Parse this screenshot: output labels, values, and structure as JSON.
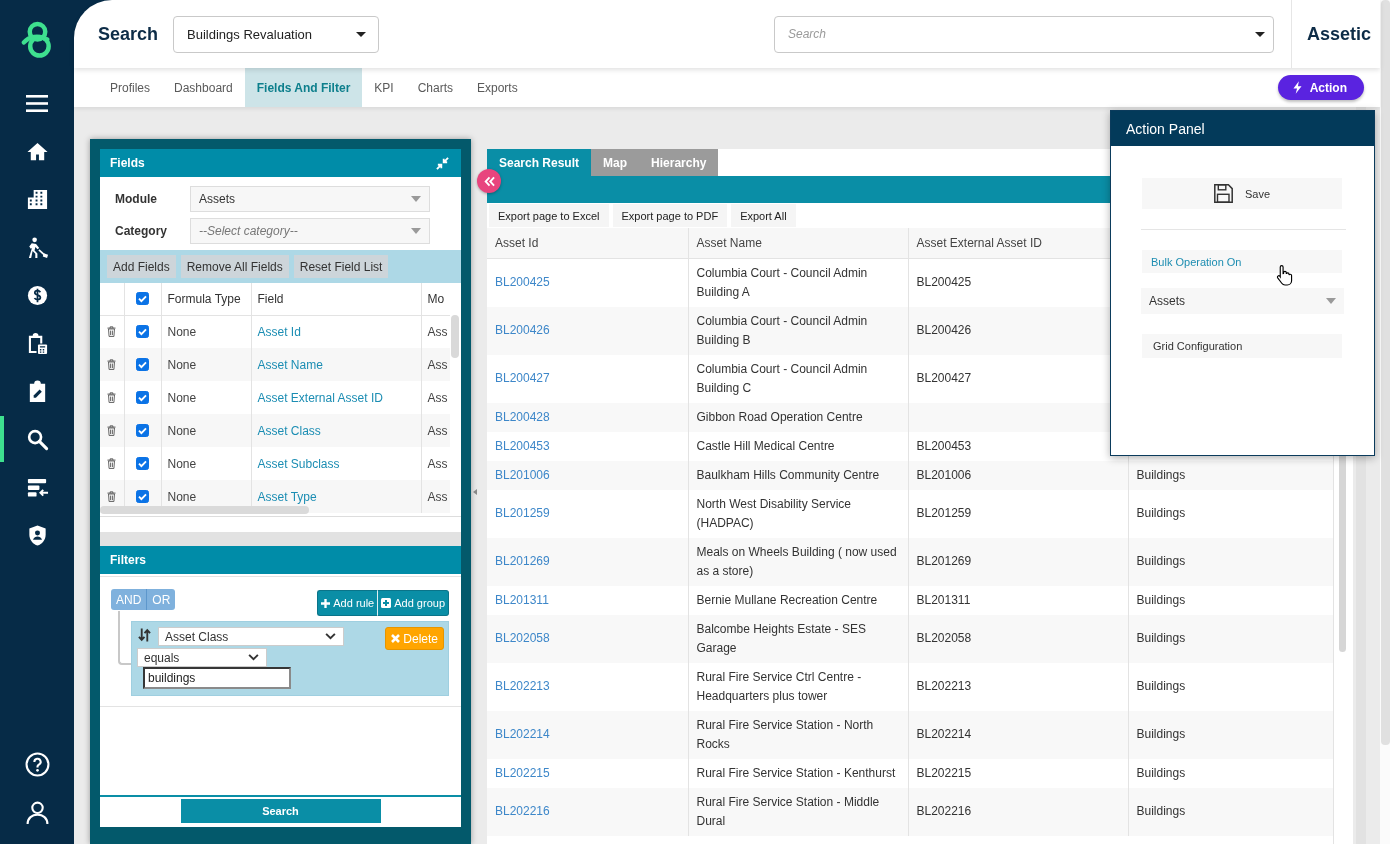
{
  "sidebar": {
    "items": [
      {
        "selected": false
      },
      {
        "selected": false
      },
      {
        "selected": false
      },
      {
        "selected": false
      },
      {
        "selected": false
      },
      {
        "selected": false
      },
      {
        "selected": true
      },
      {
        "selected": false
      },
      {
        "selected": false
      }
    ]
  },
  "header": {
    "title": "Search",
    "profile_select": {
      "value": "Buildings Revaluation"
    },
    "search": {
      "placeholder": "Search"
    },
    "brand": "Assetic"
  },
  "tabs": [
    {
      "label": "Profiles",
      "selected": false
    },
    {
      "label": "Dashboard",
      "selected": false
    },
    {
      "label": "Fields And Filter",
      "selected": true
    },
    {
      "label": "KPI",
      "selected": false
    },
    {
      "label": "Charts",
      "selected": false
    },
    {
      "label": "Exports",
      "selected": false
    }
  ],
  "action_button": {
    "label": "Action"
  },
  "fields_panel": {
    "title": "Fields",
    "module": {
      "label": "Module",
      "value": "Assets"
    },
    "category": {
      "label": "Category",
      "placeholder": "--Select category--"
    },
    "buttons": [
      "Add Fields",
      "Remove All Fields",
      "Reset Field List"
    ],
    "table": {
      "all_checked": true,
      "columns": [
        "Formula Type",
        "Field",
        "Mo"
      ],
      "rows": [
        {
          "checked": true,
          "formula_type": "None",
          "field": "Asset Id",
          "column_5": "Ass"
        },
        {
          "checked": true,
          "formula_type": "None",
          "field": "Asset Name",
          "column_5": "Ass"
        },
        {
          "checked": true,
          "formula_type": "None",
          "field": "Asset External Asset ID",
          "column_5": "Ass"
        },
        {
          "checked": true,
          "formula_type": "None",
          "field": "Asset Class",
          "column_5": "Ass"
        },
        {
          "checked": true,
          "formula_type": "None",
          "field": "Asset Subclass",
          "column_5": "Ass"
        },
        {
          "checked": true,
          "formula_type": "None",
          "field": "Asset Type",
          "column_5": "Ass"
        }
      ]
    }
  },
  "filters_panel": {
    "title": "Filters",
    "conditions": [
      "AND",
      "OR"
    ],
    "buttons": [
      "Add rule",
      "Add group"
    ],
    "rule": {
      "field": "Asset Class",
      "operator": "equals",
      "value": "buildings",
      "delete_label": "Delete"
    },
    "search_button": "Search"
  },
  "results": {
    "tabs": [
      {
        "label": "Search Result",
        "selected": true
      },
      {
        "label": "Map",
        "selected": false
      },
      {
        "label": "Hierarchy",
        "selected": false
      }
    ],
    "exports": [
      "Export page to Excel",
      "Export page to PDF",
      "Export All"
    ],
    "table": {
      "columns": [
        "Asset Id",
        "Asset Name",
        "Asset External Asset ID"
      ],
      "rows": [
        {
          "asset_id": "BL200425",
          "asset_name": "Columbia Court - Council Admin Building A",
          "asset_external_asset_id": "BL200425"
        },
        {
          "asset_id": "BL200426",
          "asset_name": "Columbia Court - Council Admin Building B",
          "asset_external_asset_id": "BL200426"
        },
        {
          "asset_id": "BL200427",
          "asset_name": "Columbia Court - Council Admin Building C",
          "asset_external_asset_id": "BL200427"
        },
        {
          "asset_id": "BL200428",
          "asset_name": "Gibbon Road Operation Centre"
        },
        {
          "asset_id": "BL200453",
          "asset_name": "Castle Hill Medical Centre",
          "asset_external_asset_id": "BL200453"
        },
        {
          "asset_id": "BL201006",
          "asset_name": "Baulkham Hills Community Centre",
          "asset_external_asset_id": "BL201006",
          "column_4": "Buildings"
        },
        {
          "asset_id": "BL201259",
          "asset_name": "North West Disability Service (HADPAC)",
          "asset_external_asset_id": "BL201259",
          "column_4": "Buildings"
        },
        {
          "asset_id": "BL201269",
          "asset_name": "Meals on Wheels Building ( now used as a store)",
          "asset_external_asset_id": "BL201269",
          "column_4": "Buildings"
        },
        {
          "asset_id": "BL201311",
          "asset_name": "Bernie Mullane Recreation Centre",
          "asset_external_asset_id": "BL201311",
          "column_4": "Buildings"
        },
        {
          "asset_id": "BL202058",
          "asset_name": "Balcombe Heights Estate - SES Garage",
          "asset_external_asset_id": "BL202058",
          "column_4": "Buildings"
        },
        {
          "asset_id": "BL202213",
          "asset_name": "Rural Fire Service Ctrl Centre - Headquarters plus tower",
          "asset_external_asset_id": "BL202213",
          "column_4": "Buildings"
        },
        {
          "asset_id": "BL202214",
          "asset_name": "Rural Fire Service Station - North Rocks",
          "asset_external_asset_id": "BL202214",
          "column_4": "Buildings"
        },
        {
          "asset_id": "BL202215",
          "asset_name": "Rural Fire Service Station - Kenthurst",
          "asset_external_asset_id": "BL202215",
          "column_4": "Buildings"
        },
        {
          "asset_id": "BL202216",
          "asset_name": "Rural Fire Service Station - Middle Dural",
          "asset_external_asset_id": "BL202216",
          "column_4": "Buildings"
        }
      ]
    }
  },
  "action_panel": {
    "title": "Action Panel",
    "save_label": "Save",
    "bulk_operation_label": "Bulk Operation On",
    "bulk_select": {
      "value": "Assets"
    },
    "grid_configuration_label": "Grid Configuration"
  }
}
